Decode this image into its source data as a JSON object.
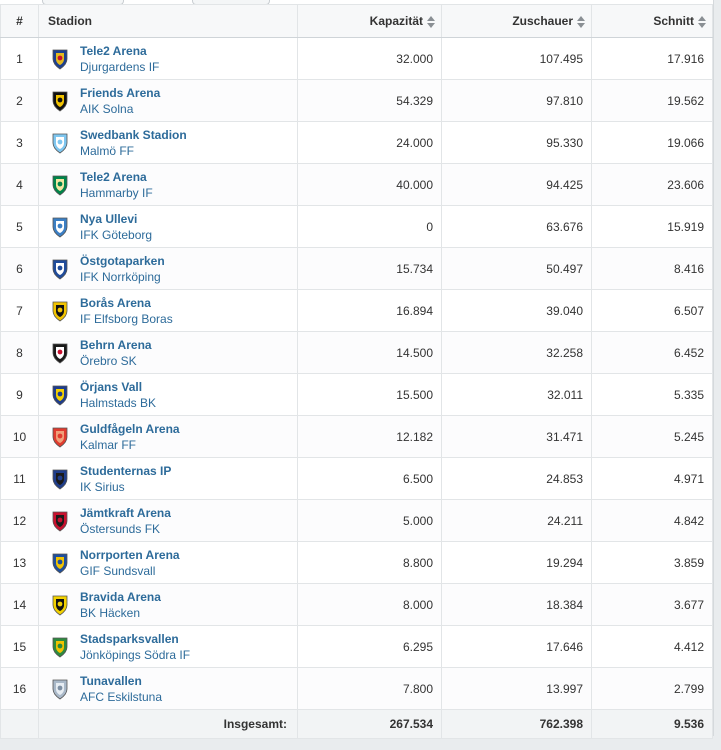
{
  "header": {
    "rank": "#",
    "stadium": "Stadion",
    "capacity": "Kapazität",
    "spectators": "Zuschauer",
    "average": "Schnitt"
  },
  "rows": [
    {
      "rank": "1",
      "stadium": "Tele2 Arena",
      "club": "Djurgardens IF",
      "capacity": "32.000",
      "spectators": "107.495",
      "average": "17.916",
      "crest": "djurgarden-crest-icon",
      "colors": [
        "#1c3f8f",
        "#e3b91f",
        "#c8102e"
      ]
    },
    {
      "rank": "2",
      "stadium": "Friends Arena",
      "club": "AIK Solna",
      "capacity": "54.329",
      "spectators": "97.810",
      "average": "19.562",
      "crest": "aik-crest-icon",
      "colors": [
        "#111111",
        "#f2c300",
        "#111111"
      ]
    },
    {
      "rank": "3",
      "stadium": "Swedbank Stadion",
      "club": "Malmö FF",
      "capacity": "24.000",
      "spectators": "95.330",
      "average": "19.066",
      "crest": "malmo-crest-icon",
      "colors": [
        "#7fc6ef",
        "#ffffff",
        "#7fc6ef"
      ]
    },
    {
      "rank": "4",
      "stadium": "Tele2 Arena",
      "club": "Hammarby IF",
      "capacity": "40.000",
      "spectators": "94.425",
      "average": "23.606",
      "crest": "hammarby-crest-icon",
      "colors": [
        "#00844a",
        "#f2e7a1",
        "#00844a"
      ]
    },
    {
      "rank": "5",
      "stadium": "Nya Ullevi",
      "club": "IFK Göteborg",
      "capacity": "0",
      "spectators": "63.676",
      "average": "15.919",
      "crest": "goteborg-crest-icon",
      "colors": [
        "#3b7fc4",
        "#ffffff",
        "#3b7fc4"
      ]
    },
    {
      "rank": "6",
      "stadium": "Östgotaparken",
      "club": "IFK Norrköping",
      "capacity": "15.734",
      "spectators": "50.497",
      "average": "8.416",
      "crest": "norrkoping-crest-icon",
      "colors": [
        "#1f4b9a",
        "#ffffff",
        "#1f4b9a"
      ]
    },
    {
      "rank": "7",
      "stadium": "Borås Arena",
      "club": "IF Elfsborg Boras",
      "capacity": "16.894",
      "spectators": "39.040",
      "average": "6.507",
      "crest": "elfsborg-crest-icon",
      "colors": [
        "#f2c400",
        "#111111",
        "#f2c400"
      ]
    },
    {
      "rank": "8",
      "stadium": "Behrn Arena",
      "club": "Örebro SK",
      "capacity": "14.500",
      "spectators": "32.258",
      "average": "6.452",
      "crest": "orebro-crest-icon",
      "colors": [
        "#1a1a1a",
        "#ffffff",
        "#c8102e"
      ]
    },
    {
      "rank": "9",
      "stadium": "Örjans Vall",
      "club": "Halmstads BK",
      "capacity": "15.500",
      "spectators": "32.011",
      "average": "5.335",
      "crest": "halmstad-crest-icon",
      "colors": [
        "#1e3c8c",
        "#f4d000",
        "#1e3c8c"
      ]
    },
    {
      "rank": "10",
      "stadium": "Guldfågeln Arena",
      "club": "Kalmar FF",
      "capacity": "12.182",
      "spectators": "31.471",
      "average": "5.245",
      "crest": "kalmar-crest-icon",
      "colors": [
        "#e03b2e",
        "#f0a07a",
        "#e03b2e"
      ]
    },
    {
      "rank": "11",
      "stadium": "Studenternas IP",
      "club": "IK Sirius",
      "capacity": "6.500",
      "spectators": "24.853",
      "average": "4.971",
      "crest": "sirius-crest-icon",
      "colors": [
        "#1f3d8a",
        "#1a1a1a",
        "#1f3d8a"
      ]
    },
    {
      "rank": "12",
      "stadium": "Jämtkraft Arena",
      "club": "Östersunds FK",
      "capacity": "5.000",
      "spectators": "24.211",
      "average": "4.842",
      "crest": "ostersund-crest-icon",
      "colors": [
        "#c8102e",
        "#1a1a1a",
        "#c8102e"
      ]
    },
    {
      "rank": "13",
      "stadium": "Norrporten Arena",
      "club": "GIF Sundsvall",
      "capacity": "8.800",
      "spectators": "19.294",
      "average": "3.859",
      "crest": "sundsvall-crest-icon",
      "colors": [
        "#1f4f9c",
        "#f2c300",
        "#1f4f9c"
      ]
    },
    {
      "rank": "14",
      "stadium": "Bravida Arena",
      "club": "BK Häcken",
      "capacity": "8.000",
      "spectators": "18.384",
      "average": "3.677",
      "crest": "hacken-crest-icon",
      "colors": [
        "#f2d100",
        "#111111",
        "#f2d100"
      ]
    },
    {
      "rank": "15",
      "stadium": "Stadsparksvallen",
      "club": "Jönköpings Södra IF",
      "capacity": "6.295",
      "spectators": "17.646",
      "average": "4.412",
      "crest": "jonkoping-crest-icon",
      "colors": [
        "#2e8a3e",
        "#f2c300",
        "#2e8a3e"
      ]
    },
    {
      "rank": "16",
      "stadium": "Tunavallen",
      "club": "AFC Eskilstuna",
      "capacity": "7.800",
      "spectators": "13.997",
      "average": "2.799",
      "crest": "eskilstuna-crest-icon",
      "colors": [
        "#a9b8c8",
        "#e7edf3",
        "#7d8fa3"
      ]
    }
  ],
  "footer": {
    "label": "Insgesamt:",
    "capacity": "267.534",
    "spectators": "762.398",
    "average": "9.536"
  }
}
